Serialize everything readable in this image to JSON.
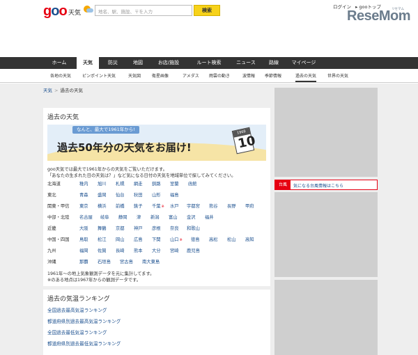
{
  "header": {
    "logo": {
      "g": "g",
      "o1": "o",
      "o2": "o"
    },
    "logo_sub": "天気",
    "search_placeholder": "地名、駅、施設、〒を入力",
    "search_button": "検索",
    "login": "ログイン",
    "goo_top": "▸ gooトップ",
    "watermark": "ReseMom",
    "watermark_sub": "リセマム"
  },
  "nav": {
    "items": [
      "ホーム",
      "天気",
      "防災",
      "地図",
      "お店/施設",
      "ルート検索",
      "ニュース",
      "路線",
      "マイページ"
    ],
    "active": "天気"
  },
  "subnav": {
    "items": [
      "各地の天気",
      "ピンポイント天気",
      "天気図",
      "衛星画像",
      "アメダス",
      "雨雲の動き",
      "波情報",
      "季節情報",
      "過去の天気",
      "世界の天気"
    ],
    "active": "過去の天気"
  },
  "breadcrumb": {
    "home": "天気",
    "sep": ">",
    "current": "過去の天気"
  },
  "panel": {
    "title": "過去の天気",
    "banner_tag": "なんと、最大で1961年から!",
    "banner_main": "過去50年分の天気をお届け!",
    "cal_year": "1969",
    "cal_num": "10",
    "desc1": "goo天気では最大で1961年からの天気をご覧いただけます。",
    "desc2": "「あなたの生まれた日の天気は？」など気になる日付の天気を地域単位で探してみてください。",
    "regions": [
      {
        "name": "北海道",
        "prefs": [
          "稚内",
          "旭川",
          "札幌",
          "網走",
          "釧路",
          "室蘭",
          "函館"
        ]
      },
      {
        "name": "東北",
        "prefs": [
          "青森",
          "盛岡",
          "仙台",
          "秋田",
          "山形",
          "福島"
        ]
      },
      {
        "name": "関東・甲信",
        "prefs": [
          "東京",
          "横浜",
          "前橋",
          "銚子",
          "千葉",
          "水戸",
          "宇都宮",
          "熊谷",
          "長野",
          "甲府"
        ]
      },
      {
        "name": "中部・北陸",
        "prefs": [
          "名古屋",
          "岐阜",
          "静岡",
          "津",
          "新潟",
          "富山",
          "金沢",
          "福井"
        ]
      },
      {
        "name": "近畿",
        "prefs": [
          "大阪",
          "舞鶴",
          "京都",
          "神戸",
          "彦根",
          "奈良",
          "和歌山"
        ]
      },
      {
        "name": "中国・四国",
        "prefs": [
          "鳥取",
          "松江",
          "岡山",
          "広島",
          "下関",
          "山口",
          "徳島",
          "高松",
          "松山",
          "高知"
        ]
      },
      {
        "name": "九州",
        "prefs": [
          "福岡",
          "佐賀",
          "長崎",
          "熊本",
          "大分",
          "宮崎",
          "鹿児島"
        ]
      },
      {
        "name": "沖縄",
        "prefs": [
          "那覇",
          "石垣島",
          "宮古島",
          "南大東島"
        ]
      }
    ],
    "star_mark": "※",
    "note1": "1961年～の地上気象観測データを元に集計してます。",
    "note2": "※のある地点は1967年からの観測データです。"
  },
  "ranking": {
    "title": "過去の気温ランキング",
    "links": [
      "全国過去最高気温ランキング",
      "都道府県別過去最高気温ランキング",
      "全国過去最低気温ランキング",
      "都道府県別過去最低気温ランキング"
    ]
  },
  "alert": {
    "tag": "台風",
    "text": "気になる台風情報はこちら"
  },
  "colors": {
    "accent": "#e60012",
    "nav": "#333333",
    "link": "#1a4f8f",
    "search_button": "#f7d21a"
  }
}
